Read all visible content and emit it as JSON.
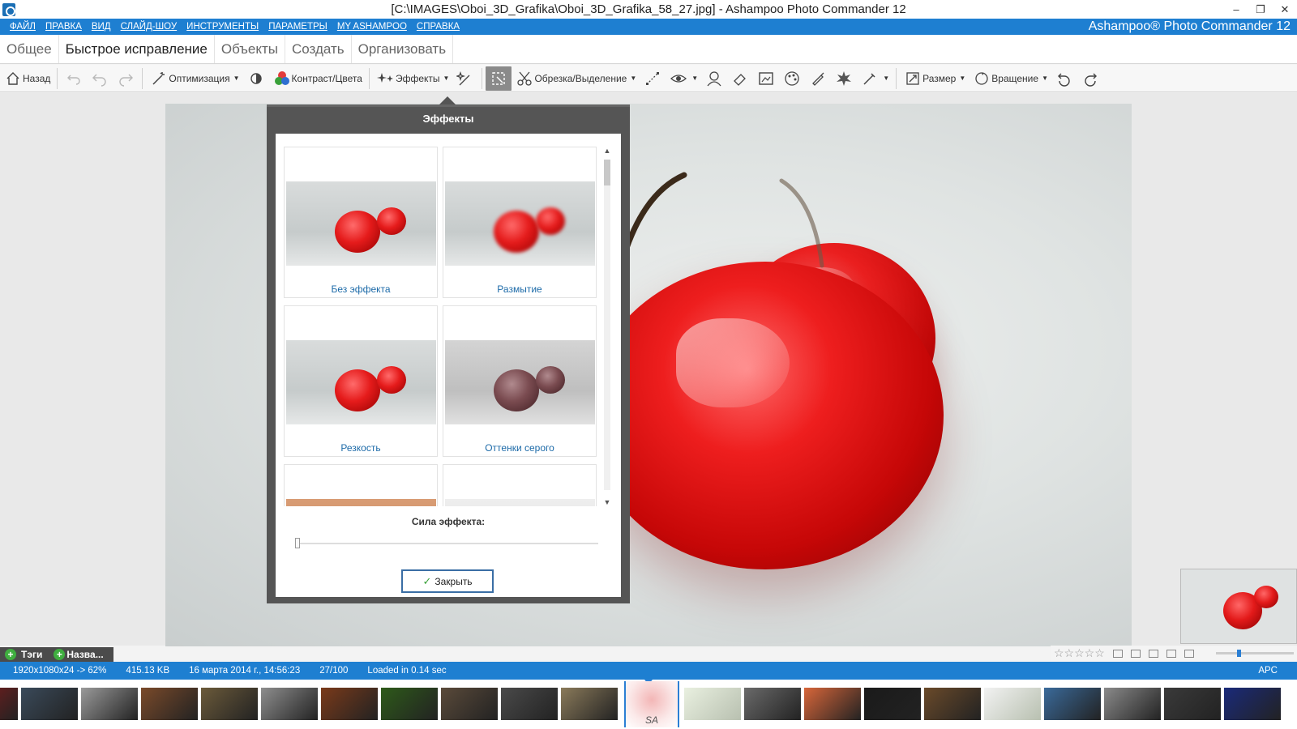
{
  "window": {
    "title": "[C:\\IMAGES\\Oboi_3D_Grafika\\Oboi_3D_Grafika_58_27.jpg] - Ashampoo Photo Commander 12",
    "minimize": "–",
    "restore": "❐",
    "close": "✕"
  },
  "menubar": {
    "items": [
      "ФАЙЛ",
      "ПРАВКА",
      "ВИД",
      "СЛАЙД-ШОУ",
      "ИНСТРУМЕНТЫ",
      "ПАРАМЕТРЫ",
      "MY ASHAMPOO",
      "СПРАВКА"
    ],
    "brand": "Ashampoo® Photo Commander 12"
  },
  "tabs": [
    {
      "label": "Общее",
      "active": false
    },
    {
      "label": "Быстрое исправление",
      "active": true
    },
    {
      "label": "Объекты",
      "active": false
    },
    {
      "label": "Создать",
      "active": false
    },
    {
      "label": "Организовать",
      "active": false
    }
  ],
  "toolbar": {
    "back": "Назад",
    "optimize": "Оптимизация",
    "contrast": "Контраст/Цвета",
    "effects": "Эффекты",
    "crop": "Обрезка/Выделение",
    "resize": "Размер",
    "rotate": "Вращение"
  },
  "effects_panel": {
    "title": "Эффекты",
    "cards": [
      {
        "label": "Без эффекта",
        "style": "normal"
      },
      {
        "label": "Размытие",
        "style": "blur"
      },
      {
        "label": "Резкость",
        "style": "normal"
      },
      {
        "label": "Оттенки серого",
        "style": "gray"
      }
    ],
    "strength_label": "Сила эффекта:",
    "strength_value": 0,
    "close_label": "Закрыть"
  },
  "tags": {
    "tags_label": "Тэги",
    "name_label": "Назва..."
  },
  "statusbar": {
    "dimensions": "1920x1080x24 -> 62%",
    "filesize": "415.13 KB",
    "date": "16 марта 2014 г., 14:56:23",
    "position": "27/100",
    "loaded": "Loaded in 0.14 sec",
    "caps": "APC"
  },
  "rating": {
    "stars": "☆☆☆☆☆"
  },
  "filmstrip": {
    "thumbs": [
      {
        "color": "#8b1c1c"
      },
      {
        "color": "#3a4a5a"
      },
      {
        "color": "#9a9a9a"
      },
      {
        "color": "#7a4a2a"
      },
      {
        "color": "#6b5a3a"
      },
      {
        "color": "#8e8e8e"
      },
      {
        "color": "#7a3a1a"
      },
      {
        "color": "#2e5a1a"
      },
      {
        "color": "#5a4a3a"
      },
      {
        "color": "#4a4a4a"
      },
      {
        "color": "#8a7a5a"
      },
      {
        "color": "#f0c8c8"
      },
      {
        "color": "#e9f0e0"
      },
      {
        "color": "#6a6a6a"
      },
      {
        "color": "#d8663a"
      },
      {
        "color": "#1a1a1a"
      },
      {
        "color": "#6a4a2a"
      },
      {
        "color": "#f2f2f2"
      },
      {
        "color": "#3a6a9a"
      },
      {
        "color": "#8a8a8a"
      },
      {
        "color": "#3a3a3a"
      },
      {
        "color": "#1a2a7a"
      }
    ],
    "current_index": 11,
    "current_badge": "SA"
  }
}
